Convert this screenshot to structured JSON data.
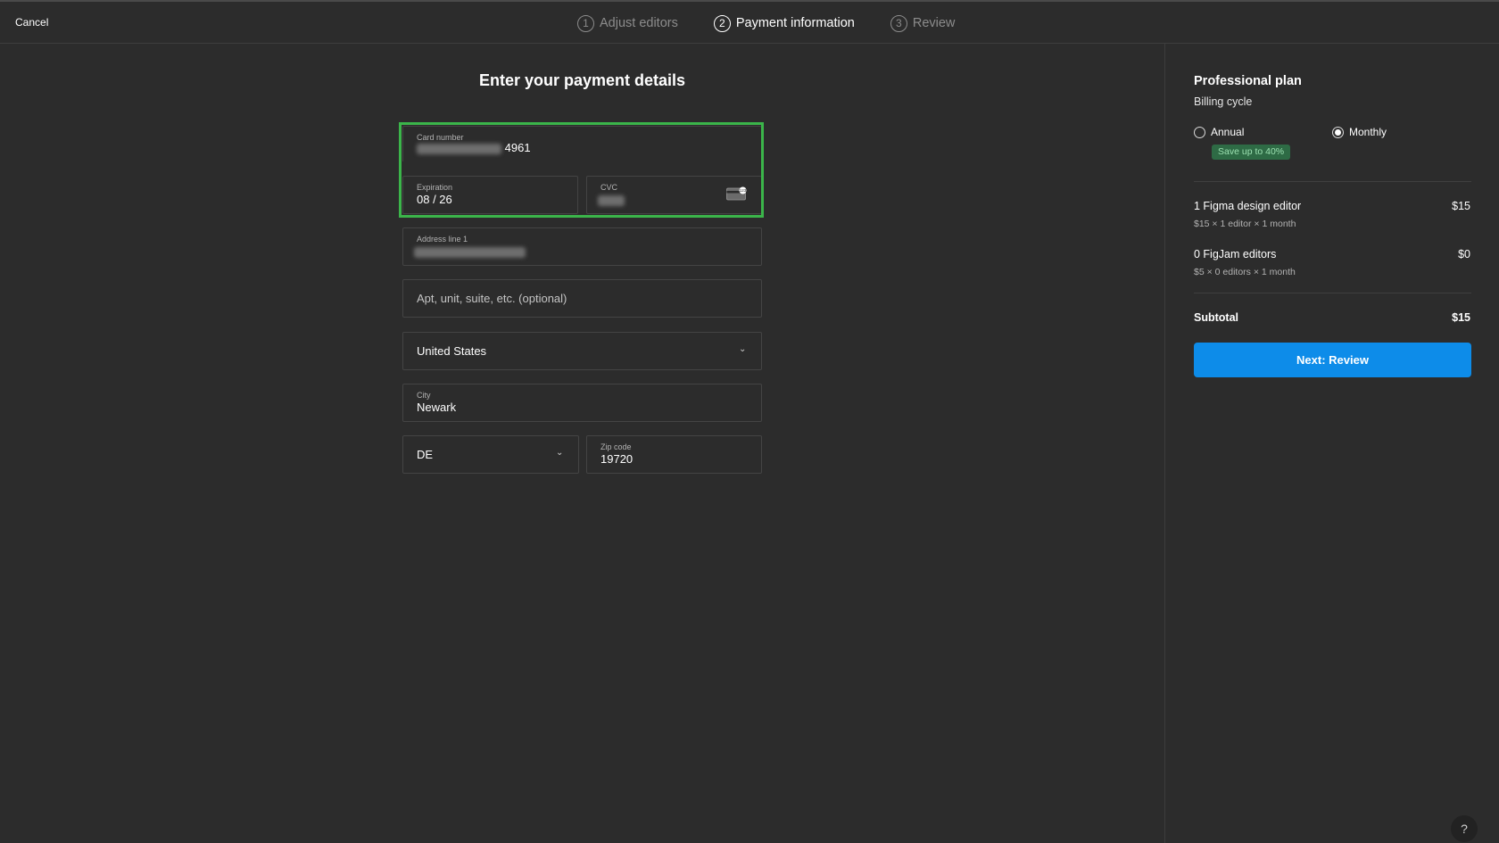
{
  "header": {
    "cancel_label": "Cancel",
    "steps": [
      {
        "number": "1",
        "label": "Adjust editors",
        "state": "done"
      },
      {
        "number": "2",
        "label": "Payment information",
        "state": "active"
      },
      {
        "number": "3",
        "label": "Review",
        "state": "upcoming"
      }
    ]
  },
  "form": {
    "title": "Enter your payment details",
    "card_number": {
      "label": "Card number",
      "value_visible_suffix": "4961",
      "value_masked": true
    },
    "expiration": {
      "label": "Expiration",
      "value": "08 / 26"
    },
    "cvc": {
      "label": "CVC",
      "value_masked": true,
      "icon": "card-cvc-icon"
    },
    "address_line1": {
      "label": "Address line 1",
      "value_masked": true
    },
    "address_line2": {
      "placeholder": "Apt, unit, suite, etc. (optional)"
    },
    "country": {
      "selected": "United States"
    },
    "city": {
      "label": "City",
      "value": "Newark"
    },
    "state": {
      "selected": "DE"
    },
    "zip": {
      "label": "Zip code",
      "value": "19720"
    }
  },
  "summary": {
    "plan_title": "Professional plan",
    "billing_cycle_label": "Billing cycle",
    "options": [
      {
        "label": "Annual",
        "selected": false,
        "badge": "Save up to 40%"
      },
      {
        "label": "Monthly",
        "selected": true
      }
    ],
    "lines": [
      {
        "title": "1 Figma design editor",
        "sub": "$15 × 1 editor × 1 month",
        "price": "$15"
      },
      {
        "title": "0 FigJam editors",
        "sub": "$5 × 0 editors × 1 month",
        "price": "$0"
      }
    ],
    "subtotal_label": "Subtotal",
    "subtotal_value": "$15",
    "next_button": "Next: Review"
  },
  "help_label": "?",
  "colors": {
    "background": "#2c2c2c",
    "accent": "#0d8ce9",
    "highlight": "#3bb54a",
    "badge_bg": "#2e6b45"
  }
}
